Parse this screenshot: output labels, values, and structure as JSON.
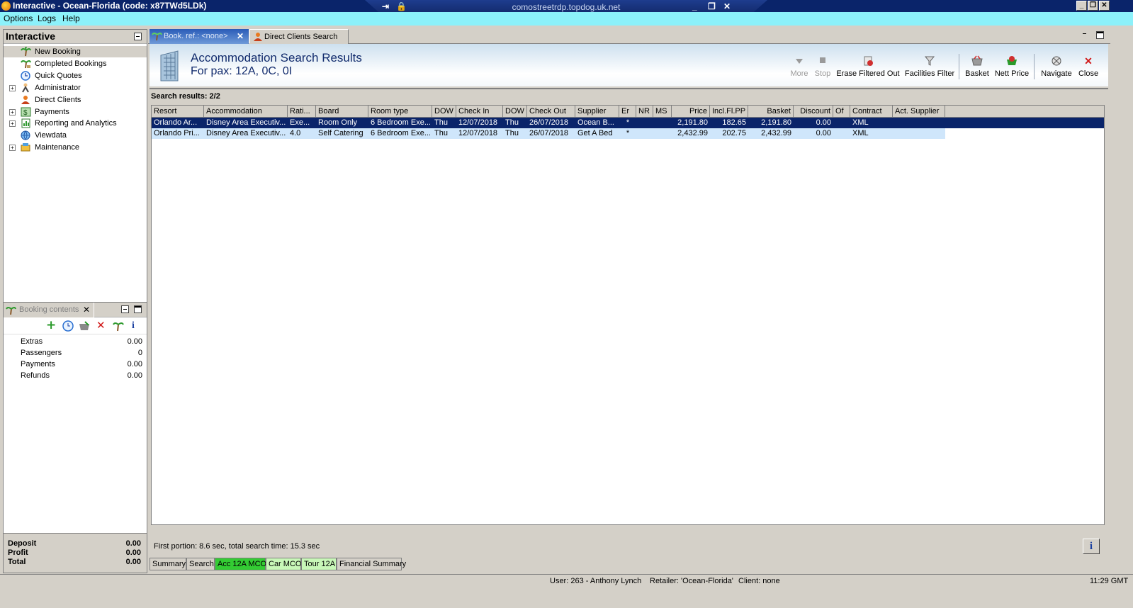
{
  "window": {
    "title": "Interactive - Ocean-Florida (code: x87TWd5LDk)",
    "rdp_host": "comostreetrdp.topdog.uk.net"
  },
  "menu": [
    "Options",
    "Logs",
    "Help"
  ],
  "nav": {
    "title": "Interactive",
    "items": [
      {
        "label": "New Booking",
        "icon": "palm-tree-icon",
        "selected": true,
        "expandable": false
      },
      {
        "label": "Completed Bookings",
        "icon": "palm-tree-icon",
        "selected": false,
        "expandable": false
      },
      {
        "label": "Quick Quotes",
        "icon": "clock-icon",
        "selected": false,
        "expandable": false
      },
      {
        "label": "Administrator",
        "icon": "admin-icon",
        "selected": false,
        "expandable": true
      },
      {
        "label": "Direct Clients",
        "icon": "person-icon",
        "selected": false,
        "expandable": false
      },
      {
        "label": "Payments",
        "icon": "payments-icon",
        "selected": false,
        "expandable": true
      },
      {
        "label": "Reporting and Analytics",
        "icon": "report-icon",
        "selected": false,
        "expandable": true
      },
      {
        "label": "Viewdata",
        "icon": "globe-icon",
        "selected": false,
        "expandable": false
      },
      {
        "label": "Maintenance",
        "icon": "tools-icon",
        "selected": false,
        "expandable": true
      }
    ]
  },
  "booking_contents": {
    "tab_label": "Booking contents",
    "rows": [
      {
        "label": "Extras",
        "value": "0.00"
      },
      {
        "label": "Passengers",
        "value": "0"
      },
      {
        "label": "Payments",
        "value": "0.00"
      },
      {
        "label": "Refunds",
        "value": "0.00"
      }
    ],
    "summary": [
      {
        "label": "Deposit",
        "value": "0.00"
      },
      {
        "label": "Profit",
        "value": "0.00"
      },
      {
        "label": "Total",
        "value": "0.00"
      }
    ]
  },
  "tabs": [
    {
      "label": "Book. ref.: <none>",
      "active": true
    },
    {
      "label": "Direct Clients Search",
      "active": false
    }
  ],
  "results": {
    "title": "Accommodation Search Results",
    "pax": "For pax: 12A, 0C, 0I",
    "count": "Search results: 2/2",
    "toolbar": [
      {
        "label": "More",
        "enabled": false
      },
      {
        "label": "Stop",
        "enabled": false
      },
      {
        "label": "Erase Filtered Out",
        "enabled": true
      },
      {
        "label": "Facilities Filter",
        "enabled": true
      },
      {
        "label": "Basket",
        "enabled": true
      },
      {
        "label": "Nett Price",
        "enabled": true
      },
      {
        "label": "Navigate",
        "enabled": true
      },
      {
        "label": "Close",
        "enabled": true
      }
    ],
    "columns": [
      "Resort",
      "Accommodation",
      "Rati...",
      "Board",
      "Room type",
      "DOW",
      "Check In",
      "DOW",
      "Check Out",
      "Supplier",
      "Er",
      "NR",
      "MS",
      "Price",
      "Incl.Fl.PP",
      "Basket",
      "Discount",
      "Of",
      "Contract",
      "Act. Supplier"
    ],
    "rows": [
      [
        "Orlando Ar...",
        "Disney Area Executiv...",
        "Exe...",
        "Room Only",
        "6 Bedroom Exe...",
        "Thu",
        "12/07/2018",
        "Thu",
        "26/07/2018",
        "Ocean B...",
        "*",
        "",
        "",
        "2,191.80",
        "182.65",
        "2,191.80",
        "0.00",
        "",
        "XML",
        ""
      ],
      [
        "Orlando Pri...",
        "Disney Area Executiv...",
        "4.0",
        "Self Catering",
        "6 Bedroom Exe...",
        "Thu",
        "12/07/2018",
        "Thu",
        "26/07/2018",
        "Get A Bed",
        "*",
        "",
        "",
        "2,432.99",
        "202.75",
        "2,432.99",
        "0.00",
        "",
        "XML",
        ""
      ]
    ],
    "status": "First portion: 8.6 sec, total search time: 15.3 sec"
  },
  "bottom_tabs": [
    {
      "label": "Summary",
      "color": "#d4d0c8"
    },
    {
      "label": "Search",
      "color": "#d4d0c8"
    },
    {
      "label": "Acc 12A MCO",
      "color": "#33cc33"
    },
    {
      "label": "Car MCO",
      "color": "#c8f7b8"
    },
    {
      "label": "Tour 12A",
      "color": "#c8f7b8"
    },
    {
      "label": "Financial Summary",
      "color": "#d4d0c8"
    }
  ],
  "statusbar": {
    "user": "User: 263 - Anthony Lynch",
    "retailer": "Retailer: 'Ocean-Florida'",
    "client": "Client: none",
    "time": "11:29 GMT"
  },
  "colors": {
    "title_bg": "#0a246a",
    "menu_bg": "#8cf1fa",
    "selected_row": "#0a246a",
    "alt_row": "#cfe6fb"
  }
}
